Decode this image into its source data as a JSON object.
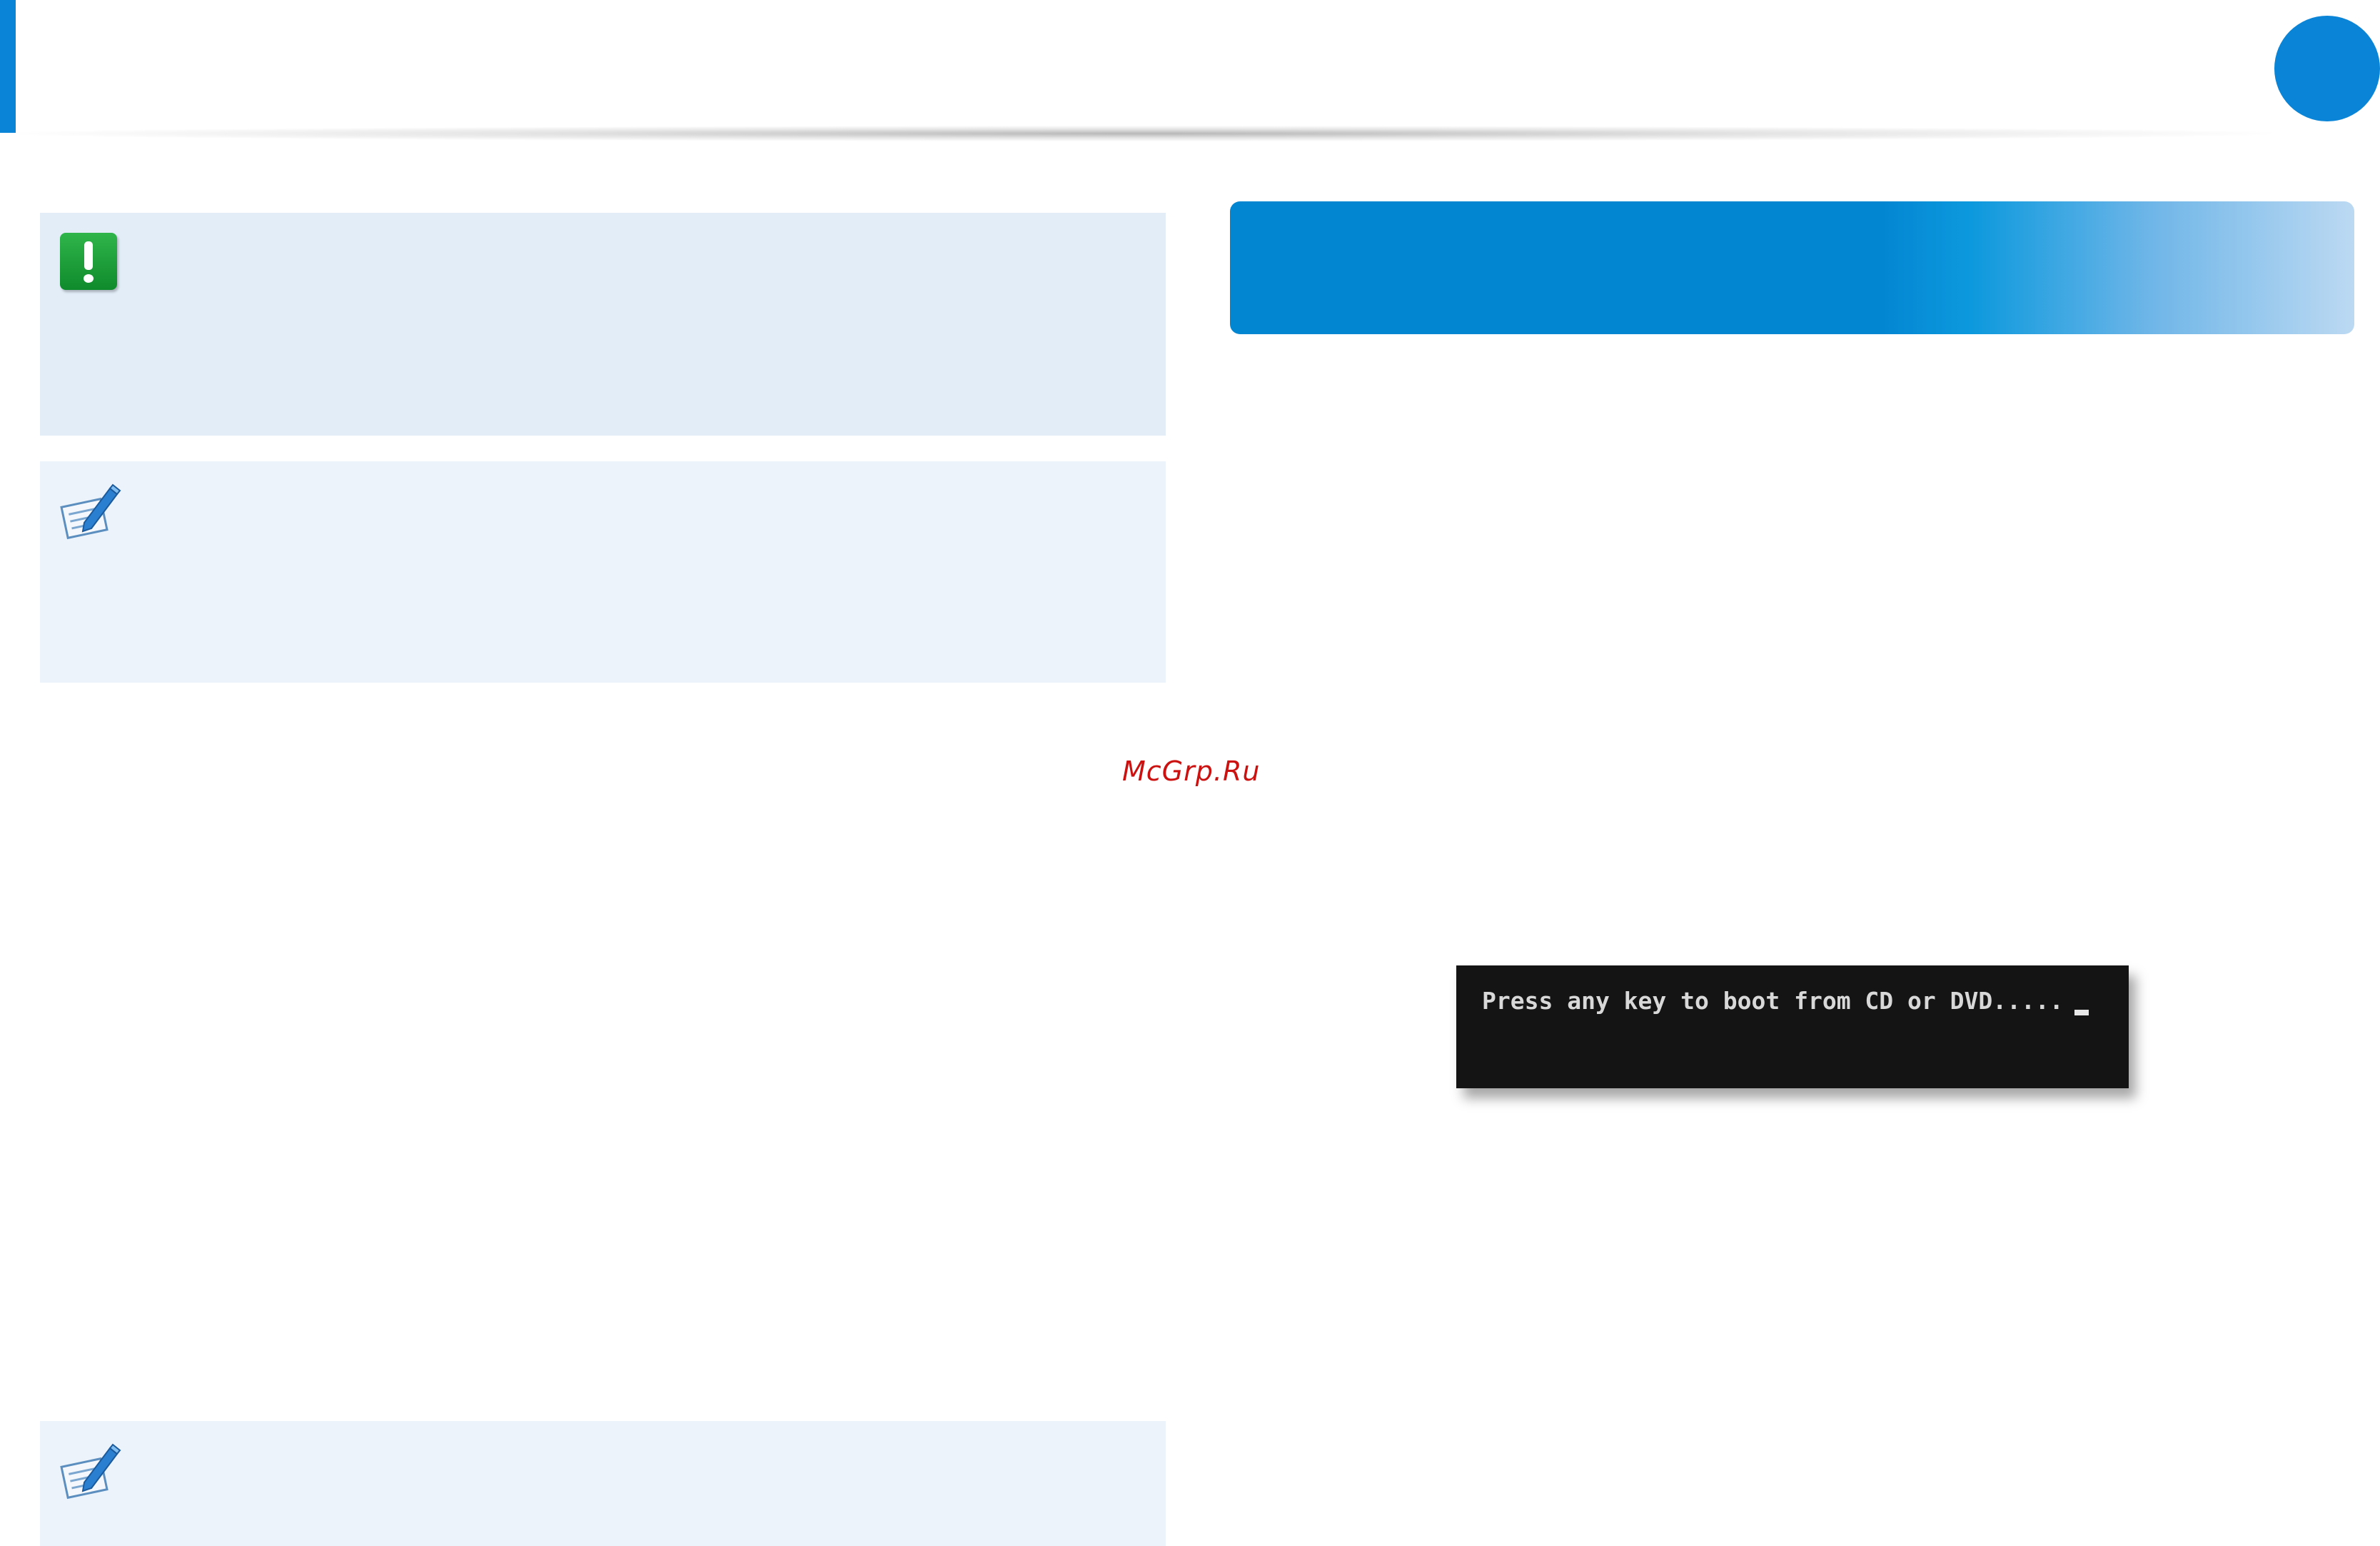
{
  "header": {
    "accent_color": "#0a84d6"
  },
  "boxes": {
    "caution_icon": "exclamation-icon",
    "caution_icon_color": "#1a9c3a",
    "note_icon": "note-pencil-icon"
  },
  "watermark": {
    "text": "McGrp.Ru"
  },
  "boot_screen": {
    "prompt": "Press any key to boot from CD or DVD....."
  }
}
